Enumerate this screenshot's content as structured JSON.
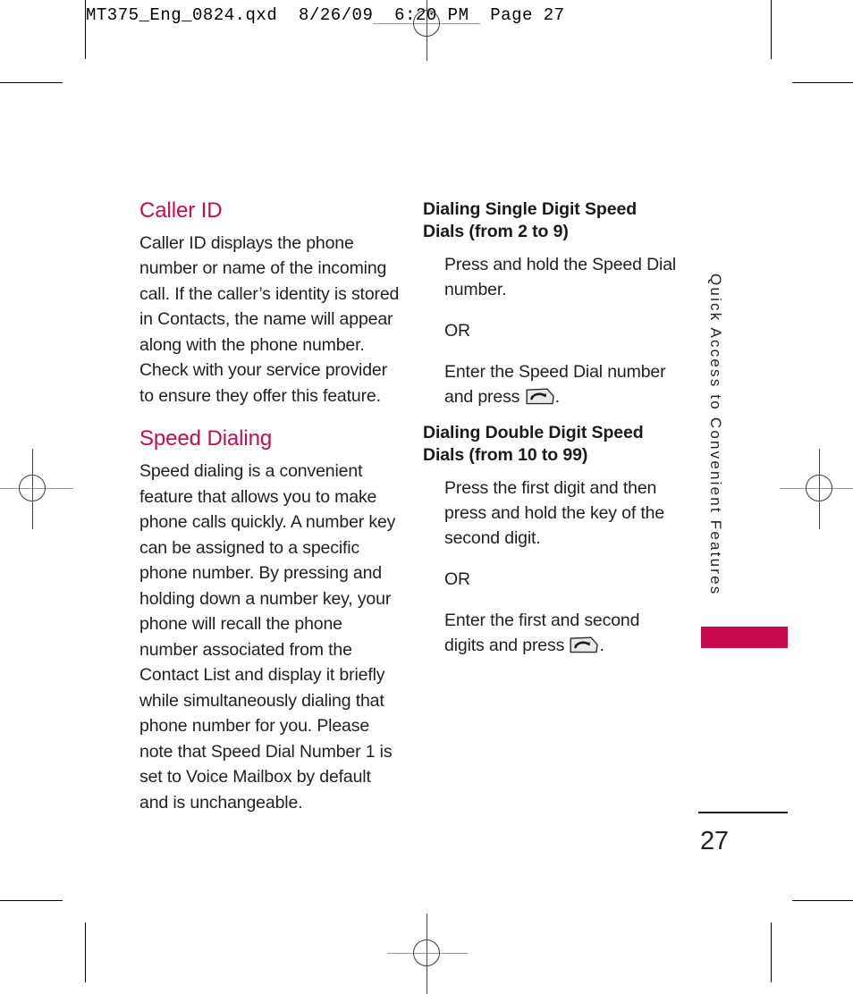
{
  "prepress": {
    "header_line": "MT375_Eng_0824.qxd  8/26/09  6:20 PM  Page 27"
  },
  "colors": {
    "heading_magenta": "#cc0a4e",
    "tab_magenta": "#c8094b",
    "body_text": "#231f20"
  },
  "page": {
    "folio": "27",
    "side_tab_label": "Quick Access to Convenient Features"
  },
  "left_column": {
    "sections": [
      {
        "title": "Caller ID",
        "body": "Caller ID displays the phone number or name of the incoming call. If the caller’s identity is stored in Contacts, the name will appear along with the phone number. Check with your service provider to ensure they offer this feature."
      },
      {
        "title": "Speed Dialing",
        "body": "Speed dialing is a convenient feature that allows you to make phone calls quickly. A number key can be assigned to a specific phone number. By pressing and holding down a number key, your phone will recall the phone number associated from the Contact List and display it briefly while simultaneously dialing that phone number for you. Please note that Speed Dial Number 1 is set to Voice Mailbox by default and is unchangeable."
      }
    ]
  },
  "right_column": {
    "sections": [
      {
        "title_line_1": "Dialing Single Digit Speed",
        "title_line_2": "Dials (from 2 to 9)",
        "step_1": "Press and hold the Speed Dial number.",
        "or_label": "OR",
        "step_2_before_icon": "Enter the Speed Dial number and press",
        "step_2_after_icon": "."
      },
      {
        "title_line_1": "Dialing Double Digit Speed",
        "title_line_2": "Dials (from 10 to 99)",
        "step_1": "Press the first digit and then press and hold the key of the second digit.",
        "or_label": "OR",
        "step_2_before_icon": "Enter the first and second digits and press",
        "step_2_after_icon": "."
      }
    ]
  },
  "icons": {
    "send_key": "send-key-icon"
  }
}
